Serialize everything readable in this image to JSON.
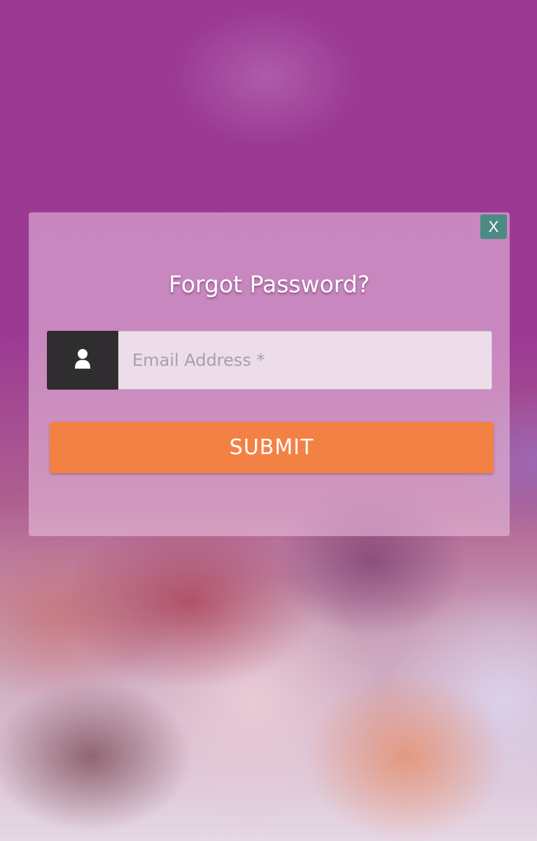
{
  "modal": {
    "close_label": "X",
    "title": "Forgot Password?",
    "email_input": {
      "placeholder": "Email Address *",
      "value": "",
      "icon": "user-icon"
    },
    "submit_label": "SUBMIT"
  },
  "colors": {
    "background_top": "#9b3993",
    "close_button": "#4d8a86",
    "icon_box": "#2f2d2f",
    "submit_button": "#f48144",
    "title_text": "#ffffff"
  }
}
